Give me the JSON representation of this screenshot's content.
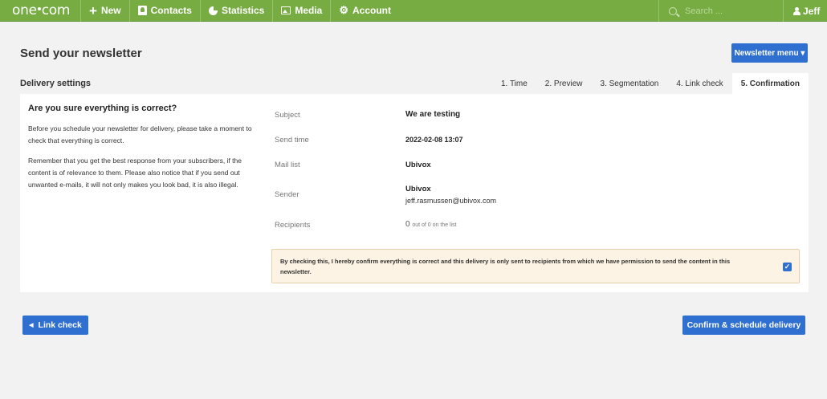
{
  "nav": {
    "brand": "one.com",
    "items": [
      {
        "label": "New",
        "icon": "plus-icon"
      },
      {
        "label": "Contacts",
        "icon": "contacts-icon"
      },
      {
        "label": "Statistics",
        "icon": "statistics-icon"
      },
      {
        "label": "Media",
        "icon": "media-icon"
      },
      {
        "label": "Account",
        "icon": "account-icon"
      }
    ],
    "search_placeholder": "Search ...",
    "user": "Jeff"
  },
  "header": {
    "title": "Send your newsletter",
    "menu_button": "Newsletter menu ▾"
  },
  "steps": {
    "section_label": "Delivery settings",
    "tabs": [
      {
        "label": "1. Time"
      },
      {
        "label": "2. Preview"
      },
      {
        "label": "3. Segmentation"
      },
      {
        "label": "4. Link check"
      },
      {
        "label": "5. Confirmation",
        "active": true
      }
    ]
  },
  "intro": {
    "heading": "Are you sure everything is correct?",
    "para1": "Before you schedule your newsletter for delivery, please take a moment to check that everything is correct.",
    "para2": "Remember that you get the best response from your subscribers, if the content is of relevance to them. Please also notice that if you send out unwanted e-mails, it will not only makes you look bad, it is also illegal."
  },
  "summary": {
    "subject_label": "Subject",
    "subject_value": "We are testing",
    "send_time_label": "Send time",
    "send_time_value": "2022-02-08 13:07",
    "mail_list_label": "Mail list",
    "mail_list_value": "Ubivox",
    "sender_label": "Sender",
    "sender_name": "Ubivox",
    "sender_email": "jeff.rasmussen@ubivox.com",
    "recipients_label": "Recipients",
    "recipients_count": "0",
    "recipients_sub": "out of 0 on the list"
  },
  "confirm": {
    "text": "By checking this, I hereby confirm everything is correct and this delivery is only sent to recipients from which we have permission to send the content in this newsletter.",
    "checked": true
  },
  "footer": {
    "back_label": "Link check",
    "confirm_label": "Confirm & schedule delivery"
  }
}
